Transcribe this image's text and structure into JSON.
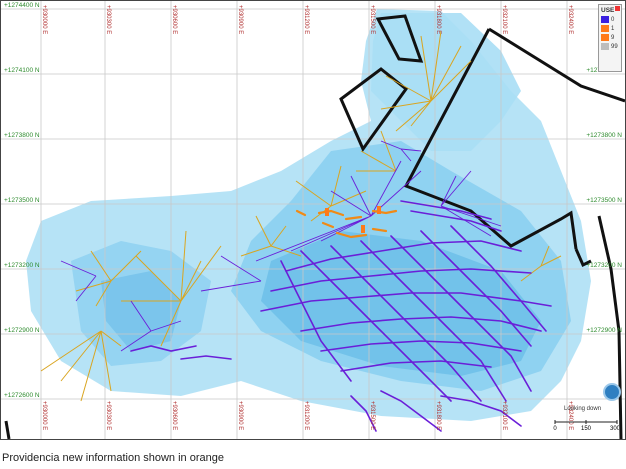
{
  "map": {
    "north_labels": [
      "+1274400 N",
      "+1274100 N",
      "+1273800 N",
      "+1273500 N",
      "+1273200 N",
      "+1272900 N",
      "+1272600 N"
    ],
    "east_labels": [
      "+930000 E",
      "+930300 E",
      "+930600 E",
      "+930900 E",
      "+931200 E",
      "+931500 E",
      "+931800 E",
      "+932100 E",
      "+932400 E"
    ],
    "colors": {
      "zone_light": "#a9def5",
      "zone_mid": "#7fcaf0",
      "zone_deep": "#5bb4e4",
      "old_data": "#6a1fd8",
      "new_data": "#f08a16",
      "drill_gold": "#d9a520",
      "boundary": "#111111"
    }
  },
  "legend": {
    "title": "USE",
    "items": [
      {
        "label": "0",
        "color": "#3a1fe0"
      },
      {
        "label": "1",
        "color": "#ff7a1a"
      },
      {
        "label": "9",
        "color": "#ff7a1a"
      },
      {
        "label": "99",
        "color": "#bdbdbd"
      }
    ]
  },
  "view": {
    "looking_down": "Looking down",
    "scale_ticks": [
      "0",
      "150",
      "300"
    ]
  },
  "caption": "Providencia new information shown in orange"
}
